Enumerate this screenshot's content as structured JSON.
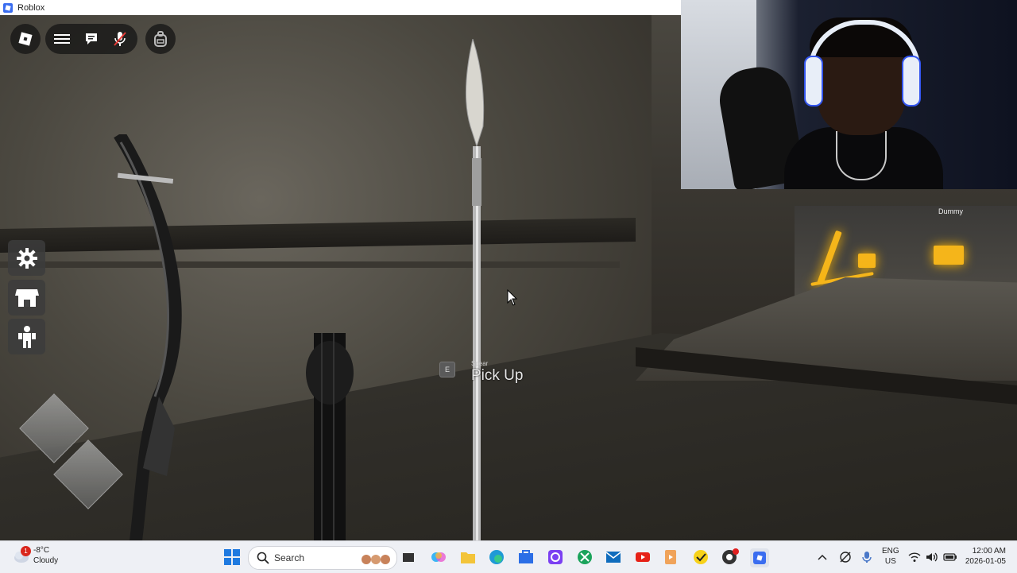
{
  "window": {
    "title": "Roblox"
  },
  "game": {
    "interaction": {
      "key": "E",
      "item": "Spear",
      "action": "Pick Up"
    },
    "target_label": "Dummy",
    "hud": {
      "top_icons": [
        "roblox-menu-icon",
        "hamburger-menu-icon",
        "chat-icon",
        "microphone-muted-icon",
        "backpack-icon"
      ],
      "side_buttons": [
        "settings-gear-icon",
        "shop-icon",
        "emote-icon"
      ]
    }
  },
  "taskbar": {
    "weather": {
      "badge": "1",
      "temp": "-8°C",
      "condition": "Cloudy"
    },
    "search_placeholder": "Search",
    "apps": [
      "start",
      "search",
      "task-view",
      "copilot",
      "file-explorer",
      "edge",
      "microsoft-store",
      "proton",
      "xbox",
      "outlook",
      "youtube",
      "media-player",
      "norton",
      "obs",
      "roblox"
    ],
    "language": {
      "line1": "ENG",
      "line2": "US"
    },
    "clock": {
      "time": "12:00 AM",
      "date": "2026-01-05"
    }
  },
  "colors": {
    "accent_glow": "#f5b51a",
    "taskbar_bg": "#eef0f5",
    "roblox_blue": "#3a6df0"
  }
}
